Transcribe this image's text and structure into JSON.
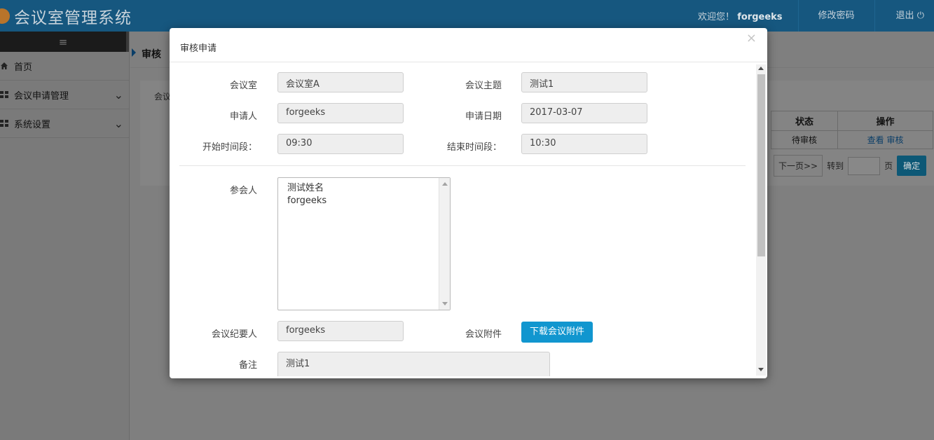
{
  "app": {
    "title": "会议室管理系统",
    "welcome_prefix": "欢迎您！",
    "username": "forgeeks",
    "change_password": "修改密码",
    "logout": "退出"
  },
  "sidebar": {
    "toggle_icon": "≡",
    "items": [
      {
        "label": "首页",
        "icon": "home-icon"
      },
      {
        "label": "会议申请管理",
        "icon": "grid-icon"
      },
      {
        "label": "系统设置",
        "icon": "grid-icon"
      }
    ]
  },
  "background": {
    "breadcrumb": "审核",
    "panel_title": "会议",
    "table": {
      "headers": [
        "状态",
        "操作"
      ],
      "row": {
        "status": "待审核",
        "view": "查看",
        "review": "审核"
      }
    },
    "pager": {
      "next": "下一页>>",
      "goto": "转到",
      "page": "页",
      "confirm": "确定"
    }
  },
  "modal": {
    "title": "审核申请",
    "close": "×",
    "fields": {
      "room_label": "会议室",
      "room_value": "会议室A",
      "topic_label": "会议主题",
      "topic_value": "测试1",
      "applicant_label": "申请人",
      "applicant_value": "forgeeks",
      "apply_date_label": "申请日期",
      "apply_date_value": "2017-03-07",
      "start_label": "开始时间段：",
      "start_value": "09:30",
      "end_label": "结束时间段：",
      "end_value": "10:30",
      "attendees_label": "参会人",
      "attendees": [
        "测试姓名",
        "forgeeks"
      ],
      "recorder_label": "会议纪要人",
      "recorder_value": "forgeeks",
      "attachment_label": "会议附件",
      "attachment_button": "下载会议附件",
      "remark_label": "备注",
      "remark_value": "测试1"
    }
  },
  "colors": {
    "topbar": "#16577f",
    "primary_button": "#1196cf"
  }
}
